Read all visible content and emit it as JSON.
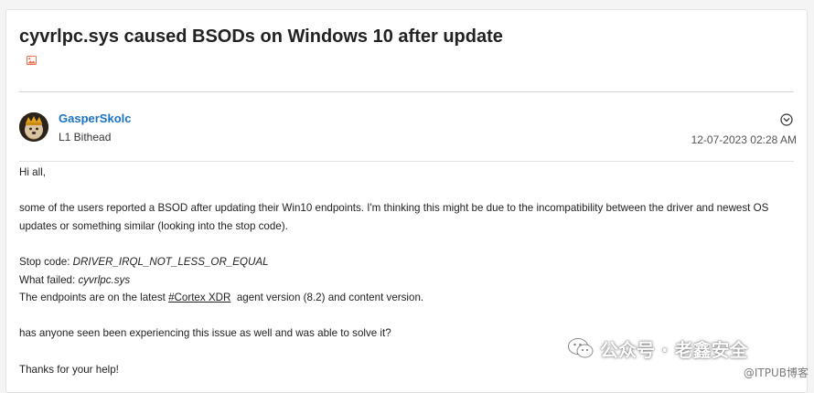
{
  "thread": {
    "title": "cyvrlpc.sys caused BSODs on Windows 10 after update",
    "image_icon": "image-icon"
  },
  "author": {
    "name": "GasperSkolc",
    "rank": "L1 Bithead",
    "avatar_icon": "avatar"
  },
  "post": {
    "date": "12-07-2023 02:28 AM",
    "options_icon": "chevron-circle-down-icon",
    "greeting": "Hi all,",
    "paragraph1": "some of the users reported a BSOD after updating their Win10 endpoints. I'm thinking this might be due to the incompatibility between the driver and newest OS updates or something similar (looking into the stop code).",
    "stop_code_label": "Stop code: ",
    "stop_code_value": "DRIVER_IRQL_NOT_LESS_OR_EQUAL",
    "what_failed_label": "What failed: ",
    "what_failed_value": "cyvrlpc.sys",
    "endpoints_prefix": "The endpoints are on the latest ",
    "hashtag": "#Cortex XDR",
    "endpoints_suffix": "  agent version (8.2) and content version.",
    "question": "has anyone seen been experiencing this issue as well and was able to solve it?",
    "thanks": "Thanks for your help!"
  },
  "watermark": {
    "text": "公众号 · 老鑫安全",
    "itpub": "@ITPUB博客"
  },
  "colors": {
    "link": "#1a73c7",
    "title": "#222222",
    "image_icon": "#e8734a"
  }
}
